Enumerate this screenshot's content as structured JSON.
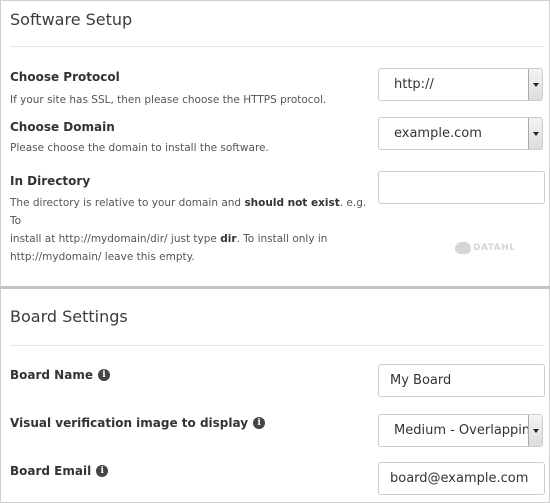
{
  "software_setup": {
    "title": "Software Setup",
    "protocol": {
      "label": "Choose Protocol",
      "description": "If your site has SSL, then please choose the HTTPS protocol.",
      "selected": "http://"
    },
    "domain": {
      "label": "Choose Domain",
      "description": "Please choose the domain to install the software.",
      "selected": "example.com"
    },
    "directory": {
      "label": "In Directory",
      "desc_1": "The directory is relative to your domain and ",
      "desc_bold_1": "should not exist",
      "desc_2": ". e.g. To",
      "desc_line2_a": "install at http://mydomain/dir/ just type ",
      "desc_bold_2": "dir",
      "desc_line2_b": ". To install only in",
      "desc_line3": "http://mydomain/ leave this empty.",
      "value": ""
    },
    "watermark": "DATAHL"
  },
  "board_settings": {
    "title": "Board Settings",
    "board_name": {
      "label": "Board Name",
      "value": "My Board"
    },
    "visual_verification": {
      "label": "Visual verification image to display",
      "selected": "Medium - Overlapping"
    },
    "board_email": {
      "label": "Board Email",
      "value": "board@example.com"
    }
  },
  "icons": {
    "info": "info-icon",
    "dropdown": "chevron-down-icon"
  }
}
